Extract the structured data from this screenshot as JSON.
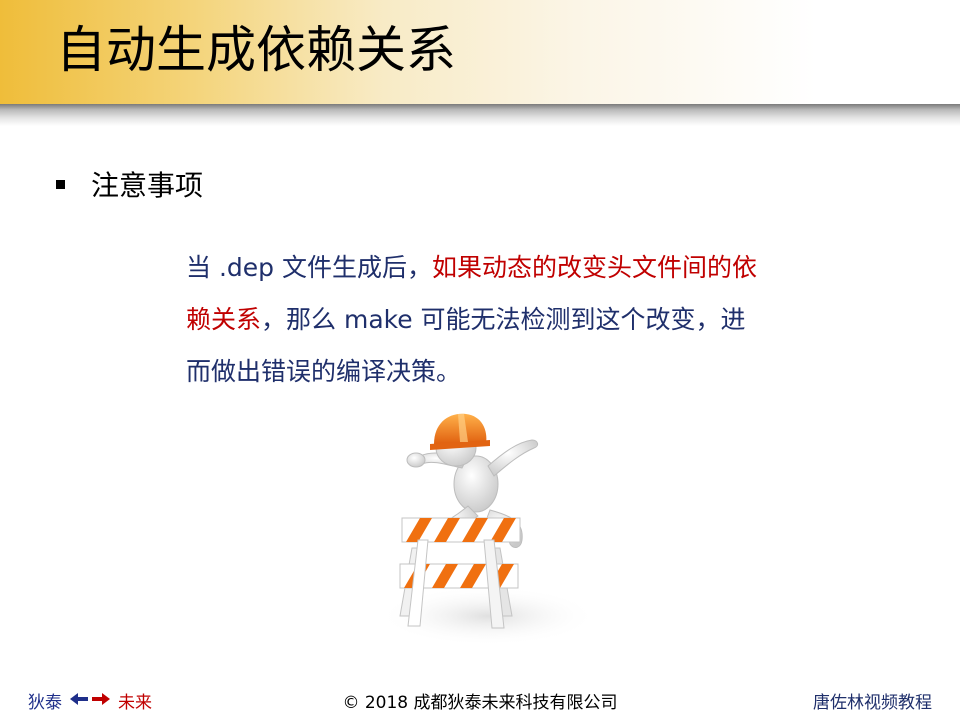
{
  "slide": {
    "title": "自动生成依赖关系",
    "bullet": "注意事项",
    "paragraph": {
      "line1_normal": "当 .dep 文件生成后，",
      "line1_highlight": "如果动态的改变头文件间的依",
      "line2_highlight": "赖关系",
      "line2_normal": "，那么 make 可能无法检测到这个改变，进",
      "line3_normal": "而做出错误的编译决策。"
    },
    "illustration_icon": "construction-worker-jumping-barricade-icon"
  },
  "footer": {
    "brand_left": "狄泰",
    "brand_right": "未来",
    "arrows_icon": "left-right-arrows-icon",
    "copyright": "© 2018 成都狄泰未来科技有限公司",
    "course": "唐佐林视频教程"
  },
  "colors": {
    "header_gold": "#efbd3a",
    "text_blue": "#1f2f6b",
    "highlight_red": "#c00000"
  }
}
